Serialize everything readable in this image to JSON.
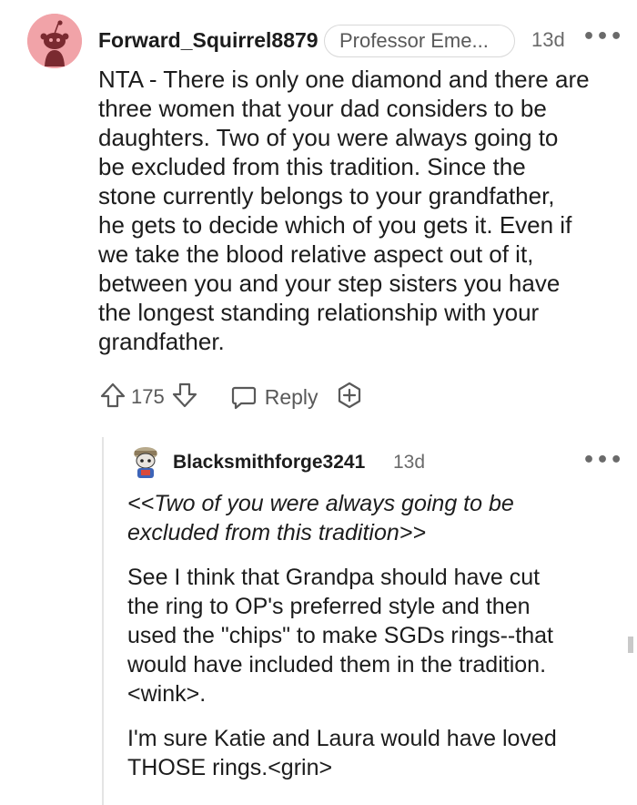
{
  "comment": {
    "username": "Forward_Squirrel8879",
    "flair": "Professor Eme...",
    "time": "13d",
    "more": "•••",
    "body_lines": [
      "NTA - There is only one diamond and there are",
      "three women that your dad considers to be",
      "daughters. Two of you were always going to",
      "be excluded from this tradition. Since the",
      "stone currently belongs to your grandfather,",
      "he gets to decide which of you gets it. Even if",
      "we take the blood relative aspect out of it,",
      "between you and your step sisters you have",
      "the longest standing relationship with your",
      "grandfather."
    ],
    "votes": "175",
    "reply_label": "Reply",
    "icons": {
      "upvote": "arrow-up-outline-icon",
      "downvote": "arrow-down-outline-icon",
      "reply": "speech-bubble-icon",
      "award": "award-plus-icon"
    },
    "avatar_color": "#f1a3a8"
  },
  "reply": {
    "username": "Blacksmithforge3241",
    "time": "13d",
    "more": "•••",
    "quote_lines": [
      "<<Two of you were always going to be",
      "excluded from this tradition>>"
    ],
    "para1_lines": [
      "See I think that Grandpa should have cut",
      "the ring to OP's preferred style and then",
      "used the \"chips\" to make SGDs rings--that",
      "would have included them in the tradition.",
      "<wink>."
    ],
    "para2_lines": [
      "I'm sure Katie and Laura would have loved",
      "THOSE rings.<grin>"
    ]
  }
}
